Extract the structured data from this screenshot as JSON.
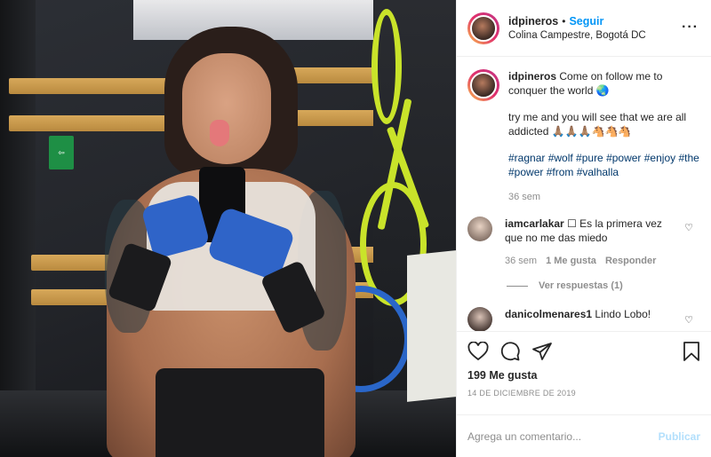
{
  "header": {
    "username": "idpineros",
    "separator": "•",
    "follow_label": "Seguir",
    "location": "Colina Campestre, Bogotá DC",
    "more_icon": "more-horizontal-icon"
  },
  "caption": {
    "username": "idpineros",
    "line1": "Come on follow me to conquer the world 🌏",
    "line2": "try me and you will see that we are all addicted 🙏🏽🙏🏽🙏🏽🐴🐴🐴",
    "hashtags": "#ragnar #wolf #pure #power #enjoy #the #power #from #valhalla",
    "time": "36 sem"
  },
  "comments": [
    {
      "username": "iamcarlakar",
      "text": "☐ Es la primera vez que no me das miedo",
      "time": "36 sem",
      "likes": "1 Me gusta",
      "reply_label": "Responder",
      "view_replies": "Ver respuestas (1)"
    },
    {
      "username": "danicolmenares1",
      "text": "Lindo Lobo!"
    }
  ],
  "actions": {
    "likes_text": "199 Me gusta",
    "date": "14 DE DICIEMBRE DE 2019"
  },
  "add_comment": {
    "placeholder": "Agrega un comentario...",
    "publish_label": "Publicar"
  },
  "colors": {
    "accent": "#0095f6",
    "hashtag": "#00376b",
    "muted": "#8e8e8e",
    "publish_disabled": "#b2dffc"
  }
}
